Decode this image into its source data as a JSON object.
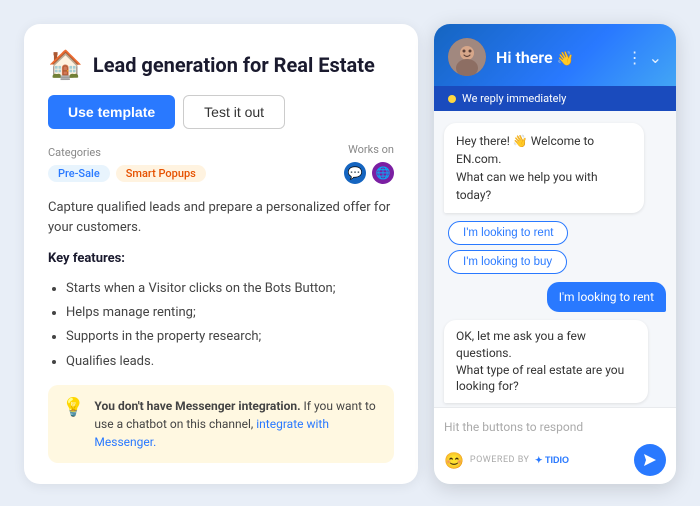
{
  "left": {
    "title": "Lead generation for Real Estate",
    "home_icon": "🏠",
    "use_template_btn": "Use template",
    "test_it_out_btn": "Test it out",
    "categories_label": "Categories",
    "works_on_label": "Works on",
    "tags": [
      {
        "label": "Pre-Sale",
        "type": "presale"
      },
      {
        "label": "Smart Popups",
        "type": "smart"
      }
    ],
    "description": "Capture qualified leads and prepare a personalized offer for your customers.",
    "key_features_label": "Key features:",
    "features": [
      "Starts when a Visitor clicks on the Bots Button;",
      "Helps manage renting;",
      "Supports in the property research;",
      "Qualifies leads."
    ],
    "notice_text_bold": "You don't have Messenger integration.",
    "notice_text": " If you want to use a chatbot on this channel, ",
    "notice_link": "integrate with Messenger.",
    "notice_icon": "💡"
  },
  "chat": {
    "header_title": "Hi there",
    "header_emoji": "👋",
    "status_text": "We reply immediately",
    "bot_message1": "Hey there! 👋 Welcome to EN.com.\nWhat can we help you with today?",
    "quick_reply1": "I'm looking to rent",
    "quick_reply2": "I'm looking to buy",
    "user_message": "I'm looking to rent",
    "bot_message2": "OK, let me ask you a few questions.\nWhat type of real estate are you\nlooking for?",
    "input_placeholder": "Hit the buttons to respond",
    "powered_by_label": "POWERED BY",
    "tidio_label": "TIDIO",
    "send_icon": "➤",
    "emoji_icon": "😊",
    "avatar_emoji": "👩"
  }
}
